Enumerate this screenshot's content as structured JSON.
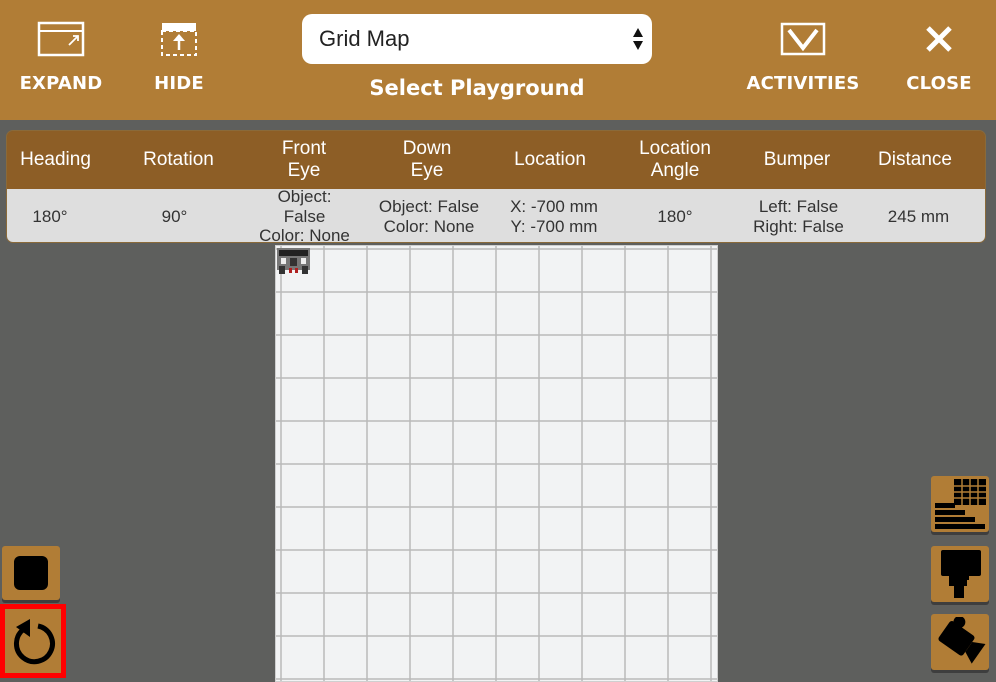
{
  "header": {
    "expand_label": "EXPAND",
    "hide_label": "HIDE",
    "activities_label": "ACTIVITIES",
    "close_label": "CLOSE",
    "playground_select_value": "Grid Map",
    "playground_title": "Select Playground"
  },
  "stats": {
    "headers": {
      "heading": "Heading",
      "rotation": "Rotation",
      "front_eye_1": "Front",
      "front_eye_2": "Eye",
      "down_eye_1": "Down",
      "down_eye_2": "Eye",
      "location": "Location",
      "location_angle_1": "Location",
      "location_angle_2": "Angle",
      "bumper": "Bumper",
      "distance": "Distance"
    },
    "values": {
      "heading": "180°",
      "rotation": "90°",
      "front_eye_object": "Object: False",
      "front_eye_color": "Color: None",
      "down_eye_object": "Object: False",
      "down_eye_color": "Color: None",
      "location_x": "X: -700 mm",
      "location_y": "Y: -700 mm",
      "location_angle": "180°",
      "bumper_left": "Left: False",
      "bumper_right": "Right: False",
      "distance": "245 mm"
    }
  },
  "colors": {
    "header_bg": "#b17d36",
    "table_header_bg": "#8d5e26",
    "table_values_bg": "#dedede",
    "workspace_bg": "#5e5f5d",
    "grid_bg": "#f2f3f4",
    "highlight_border": "#ff0000"
  },
  "icons": {
    "expand": "expand-window-icon",
    "hide": "hide-panel-icon",
    "activities": "activities-icon",
    "close": "close-x-icon",
    "stop": "stop-square-icon",
    "reset": "reset-rotate-icon",
    "data_table": "data-table-icon",
    "pen": "pen-marker-icon",
    "camera": "camera-view-icon"
  }
}
